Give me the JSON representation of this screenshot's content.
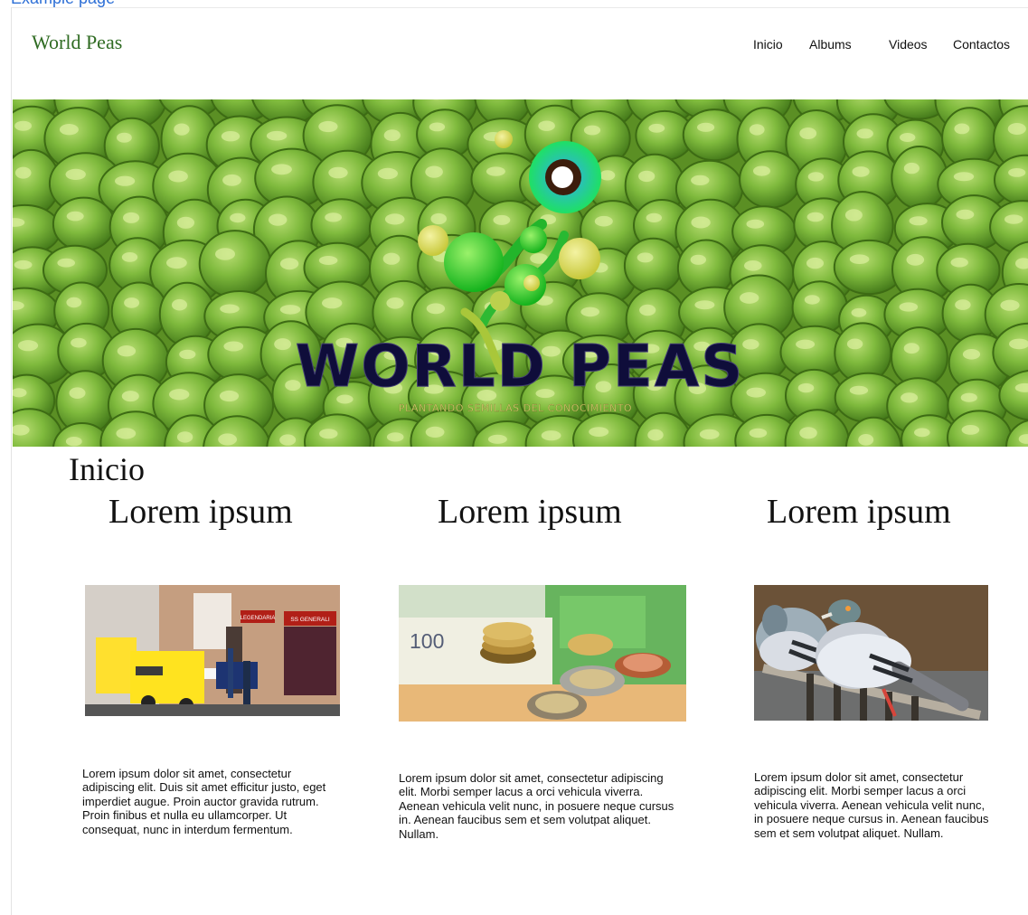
{
  "header": {
    "site_title": "World Peas",
    "nav": [
      "Inicio",
      "Albums",
      "Videos",
      "Contactos"
    ]
  },
  "hero": {
    "logo_text": "WORLD PEAS",
    "logo_tagline": "PLANTANDO SEMILLAS DEL CONOCIMIENTO"
  },
  "main": {
    "section_title": "Inicio",
    "cards": [
      {
        "heading": "Lorem ipsum",
        "text": "Lorem ipsum dolor sit amet, consectetur adipiscing elit. Duis sit amet efficitur justo, eget imperdiet augue. Proin auctor gravida rutrum. Proin finibus et nulla eu ullamcorper. Ut consequat, nunc in interdum fermentum.",
        "image_storefront_text_1": "LEGENDARIA",
        "image_storefront_text_2": "SS GENERALI"
      },
      {
        "heading": "Lorem ipsum",
        "text": "Lorem ipsum dolor sit amet, consectetur adipiscing elit. Morbi semper lacus a orci vehicula viverra. Aenean vehicula velit nunc, in posuere neque cursus in. Aenean faucibus sem et sem volutpat aliquet. Nullam.",
        "image_banknote_text": "100"
      },
      {
        "heading": "Lorem ipsum",
        "text": "Lorem ipsum dolor sit amet, consectetur adipiscing elit. Morbi semper lacus a orci vehicula viverra. Aenean vehicula velit nunc, in posuere neque cursus in. Aenean faucibus sem et sem volutpat aliquet. Nullam."
      }
    ]
  },
  "colors": {
    "site_title": "#2f6b22",
    "logo_dark": "#0f0d3a",
    "pea_green": "#79b43a"
  }
}
